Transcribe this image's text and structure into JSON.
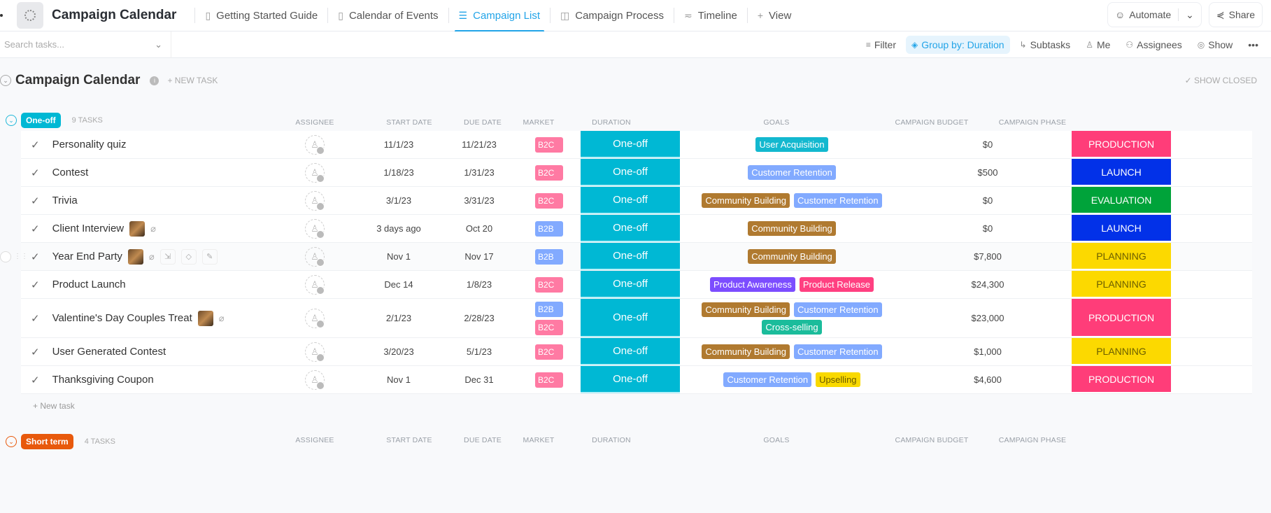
{
  "header": {
    "space_icon": "spinner-icon",
    "title": "Campaign Calendar",
    "tabs": [
      {
        "label": "Getting Started Guide",
        "icon": "doc-icon",
        "active": false
      },
      {
        "label": "Calendar of Events",
        "icon": "doc-icon",
        "active": false
      },
      {
        "label": "Campaign List",
        "icon": "list-icon",
        "active": true
      },
      {
        "label": "Campaign Process",
        "icon": "board-icon",
        "active": false
      },
      {
        "label": "Timeline",
        "icon": "timeline-icon",
        "active": false
      },
      {
        "label": "View",
        "icon": "plus-icon",
        "active": false
      }
    ],
    "automate_label": "Automate",
    "share_label": "Share"
  },
  "toolbar": {
    "search_placeholder": "Search tasks...",
    "filter_label": "Filter",
    "group_by_label": "Group by: Duration",
    "subtasks_label": "Subtasks",
    "me_label": "Me",
    "assignees_label": "Assignees",
    "show_label": "Show",
    "more_label": "•••"
  },
  "list": {
    "title": "Campaign Calendar",
    "new_task_label": "+ NEW TASK",
    "show_closed_label": "SHOW CLOSED"
  },
  "columns": {
    "assignee": "ASSIGNEE",
    "start_date": "START DATE",
    "due_date": "DUE DATE",
    "market": "MARKET",
    "duration": "DURATION",
    "goals": "GOALS",
    "budget": "CAMPAIGN BUDGET",
    "phase": "CAMPAIGN PHASE"
  },
  "colors": {
    "accent": "#22a4e8",
    "one_off": "#00b8d4",
    "short_term": "#e8590c",
    "B2C": "#ff7aa3",
    "B2B": "#82aaff",
    "User Acquisition": "#13b8cf",
    "Customer Retention": "#82aaff",
    "Community Building": "#b07a30",
    "Product Awareness": "#7c4dff",
    "Product Release": "#ff4081",
    "Cross-selling": "#1bbc9b",
    "Upselling": "#f9d900",
    "PRODUCTION": "#ff3d79",
    "LAUNCH": "#0231e8",
    "EVALUATION": "#00a33a",
    "PLANNING": "#fcd900"
  },
  "groups": [
    {
      "name": "One-off",
      "count_label": "9 TASKS",
      "new_task_label": "+ New task",
      "tasks": [
        {
          "name": "Personality quiz",
          "start": "11/1/23",
          "due": "11/21/23",
          "market": [
            "B2C"
          ],
          "duration": "One-off",
          "goals": [
            "User Acquisition"
          ],
          "budget": "$0",
          "phase": "PRODUCTION",
          "thumb": false,
          "clip": false
        },
        {
          "name": "Contest",
          "start": "1/18/23",
          "due": "1/31/23",
          "market": [
            "B2C"
          ],
          "duration": "One-off",
          "goals": [
            "Customer Retention"
          ],
          "budget": "$500",
          "phase": "LAUNCH",
          "thumb": false,
          "clip": false
        },
        {
          "name": "Trivia",
          "start": "3/1/23",
          "due": "3/31/23",
          "market": [
            "B2C"
          ],
          "duration": "One-off",
          "goals": [
            "Community Building",
            "Customer Retention"
          ],
          "budget": "$0",
          "phase": "EVALUATION",
          "thumb": false,
          "clip": false
        },
        {
          "name": "Client Interview",
          "start": "3 days ago",
          "due": "Oct 20",
          "market": [
            "B2B"
          ],
          "duration": "One-off",
          "goals": [
            "Community Building"
          ],
          "budget": "$0",
          "phase": "LAUNCH",
          "thumb": true,
          "clip": true
        },
        {
          "name": "Year End Party",
          "start": "Nov 1",
          "due": "Nov 17",
          "market": [
            "B2B"
          ],
          "duration": "One-off",
          "goals": [
            "Community Building"
          ],
          "budget": "$7,800",
          "phase": "PLANNING",
          "thumb": true,
          "clip": true,
          "hover": true
        },
        {
          "name": "Product Launch",
          "start": "Dec 14",
          "due": "1/8/23",
          "market": [
            "B2C"
          ],
          "duration": "One-off",
          "goals": [
            "Product Awareness",
            "Product Release"
          ],
          "budget": "$24,300",
          "phase": "PLANNING",
          "thumb": false,
          "clip": false
        },
        {
          "name": "Valentine's Day Couples Treat",
          "start": "2/1/23",
          "due": "2/28/23",
          "market": [
            "B2B",
            "B2C"
          ],
          "duration": "One-off",
          "goals": [
            "Community Building",
            "Customer Retention",
            "Cross-selling"
          ],
          "budget": "$23,000",
          "phase": "PRODUCTION",
          "thumb": true,
          "clip": true
        },
        {
          "name": "User Generated Contest",
          "start": "3/20/23",
          "due": "5/1/23",
          "market": [
            "B2C"
          ],
          "duration": "One-off",
          "goals": [
            "Community Building",
            "Customer Retention"
          ],
          "budget": "$1,000",
          "phase": "PLANNING",
          "thumb": false,
          "clip": false
        },
        {
          "name": "Thanksgiving Coupon",
          "start": "Nov 1",
          "due": "Dec 31",
          "market": [
            "B2C"
          ],
          "duration": "One-off",
          "goals": [
            "Customer Retention",
            "Upselling"
          ],
          "budget": "$4,600",
          "phase": "PRODUCTION",
          "thumb": false,
          "clip": false
        }
      ]
    },
    {
      "name": "Short term",
      "count_label": "4 TASKS",
      "tasks": []
    }
  ]
}
